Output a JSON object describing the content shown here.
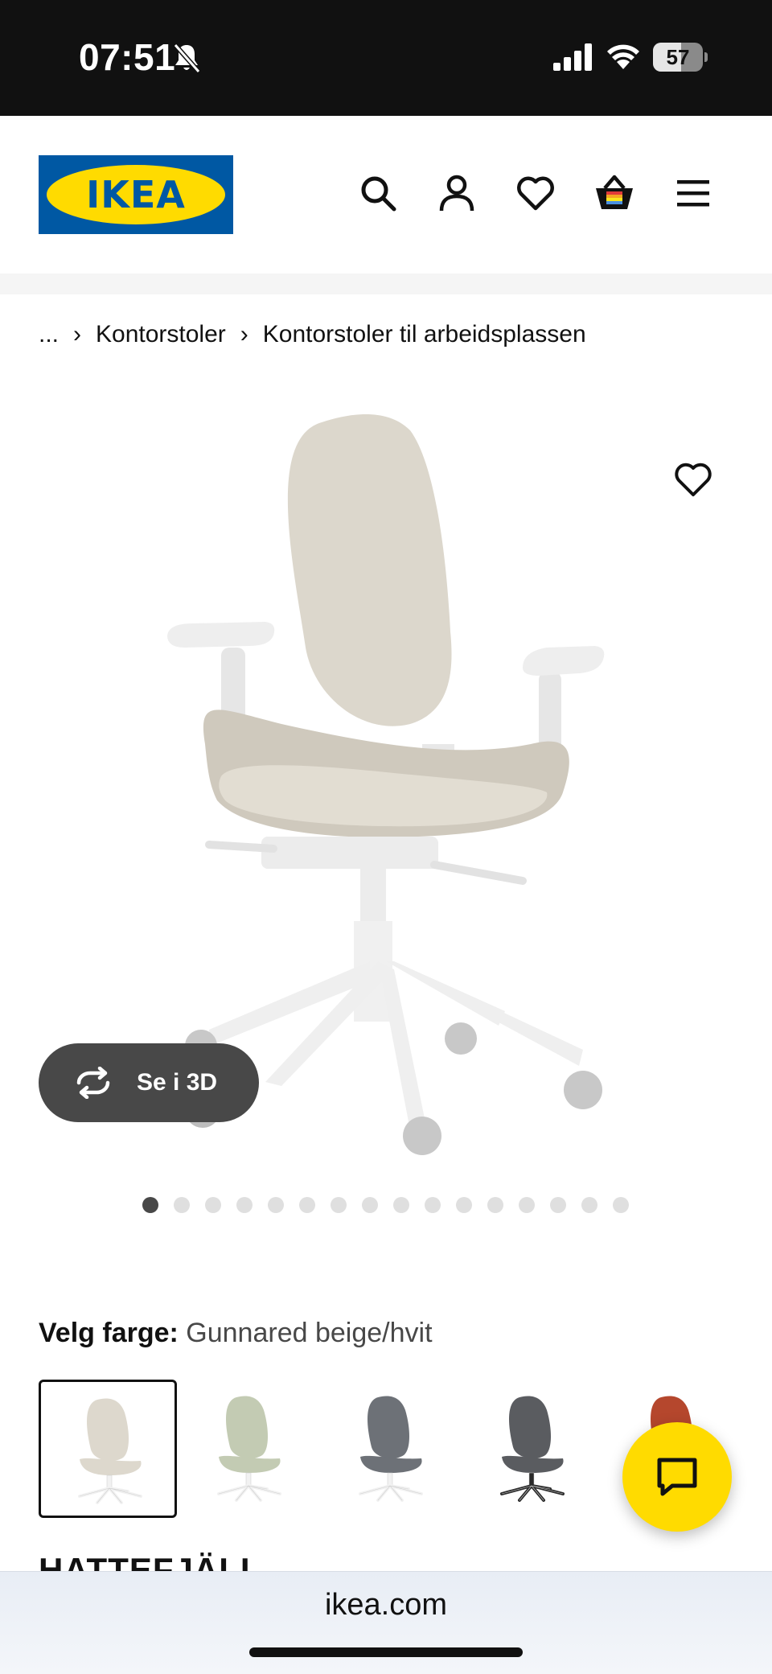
{
  "status_bar": {
    "time": "07:51",
    "battery": "57",
    "battery_level": 0.57
  },
  "header": {
    "logo_text": "IKEA",
    "icons": [
      "search-icon",
      "account-icon",
      "favourites-icon",
      "basket-icon",
      "menu-icon"
    ]
  },
  "breadcrumb": {
    "ellipsis": "...",
    "items": [
      "Kontorstoler",
      "Kontorstoler til arbeidsplassen"
    ]
  },
  "gallery": {
    "view_3d_label": "Se i 3D",
    "dot_count": 16,
    "active_index": 0
  },
  "color": {
    "label": "Velg farge:",
    "value": "Gunnared beige/hvit",
    "swatches": [
      {
        "seat": "#ddd8cd",
        "base": "#f2f2f2",
        "selected": true
      },
      {
        "seat": "#c3cbb3",
        "base": "#f2f2f2",
        "selected": false
      },
      {
        "seat": "#6d7177",
        "base": "#f2f2f2",
        "selected": false
      },
      {
        "seat": "#5a5c60",
        "base": "#2a2a2a",
        "selected": false
      },
      {
        "seat": "#b5472d",
        "base": "#f2f2f2",
        "selected": false
      }
    ]
  },
  "product": {
    "name": "HATTEFJÄLL"
  },
  "browser": {
    "url": "ikea.com"
  },
  "colors": {
    "ikea_blue": "#0058a3",
    "ikea_yellow": "#ffdb00",
    "dark_gray": "#484848"
  }
}
